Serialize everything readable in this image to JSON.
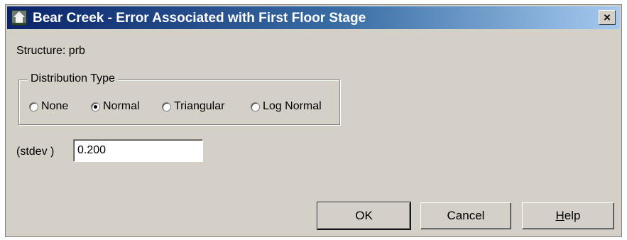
{
  "window": {
    "title": "Bear Creek - Error Associated with First Floor Stage",
    "icon": "house-flood-icon",
    "close_label": "×"
  },
  "structure_label": "Structure:  prb",
  "distribution": {
    "group_label": "Distribution Type",
    "options": [
      {
        "label": "None",
        "checked": false
      },
      {
        "label": "Normal",
        "checked": true
      },
      {
        "label": "Triangular",
        "checked": false
      },
      {
        "label": "Log Normal",
        "checked": false
      }
    ]
  },
  "stdev": {
    "label": "(stdev )",
    "value": "0.200"
  },
  "buttons": {
    "ok": "OK",
    "cancel": "Cancel",
    "help_first": "H",
    "help_rest": "elp"
  }
}
